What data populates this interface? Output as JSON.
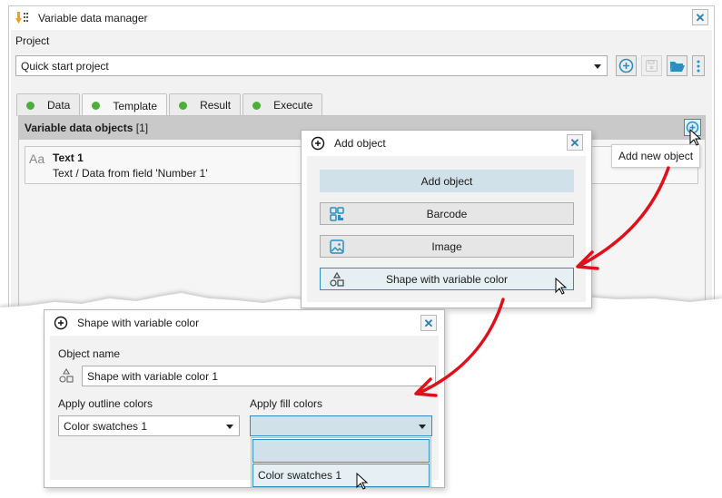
{
  "main_window": {
    "title": "Variable data manager",
    "close_glyph": "✕",
    "project_label": "Project",
    "project_value": "Quick start project",
    "toolbar_icons": [
      "add-circle-icon",
      "save-icon",
      "folder-open-icon",
      "more-vertical-icon"
    ],
    "tabs": [
      {
        "label": "Data",
        "status_color": "#4caf3a"
      },
      {
        "label": "Template",
        "status_color": "#4caf3a",
        "active": true
      },
      {
        "label": "Result",
        "status_color": "#4caf3a"
      },
      {
        "label": "Execute",
        "status_color": "#4caf3a"
      }
    ],
    "panel": {
      "title": "Variable data objects",
      "count": "[1]",
      "items": [
        {
          "icon": "text-icon",
          "icon_glyph": "Aa",
          "name": "Text 1",
          "description": "Text / Data from field 'Number 1'"
        }
      ]
    },
    "tooltip": "Add new object"
  },
  "add_object_dialog": {
    "title": "Add object",
    "close_glyph": "✕",
    "header_button": "Add object",
    "buttons": [
      {
        "label": "Barcode",
        "icon": "barcode-icon"
      },
      {
        "label": "Image",
        "icon": "image-icon"
      },
      {
        "label": "Shape with variable color",
        "icon": "shapes-icon",
        "hovered": true
      }
    ]
  },
  "shape_dialog": {
    "title": "Shape with variable color",
    "close_glyph": "✕",
    "object_name_label": "Object name",
    "object_name_value": "Shape with variable color 1",
    "outline_label": "Apply outline colors",
    "outline_value": "Color swatches 1",
    "fill_label": "Apply fill colors",
    "fill_value": "",
    "fill_options": [
      "",
      "Color swatches 1"
    ]
  },
  "colors": {
    "accent": "#2a8fc0",
    "annotation_arrow": "#e0101b",
    "status_ok": "#4caf3a"
  }
}
